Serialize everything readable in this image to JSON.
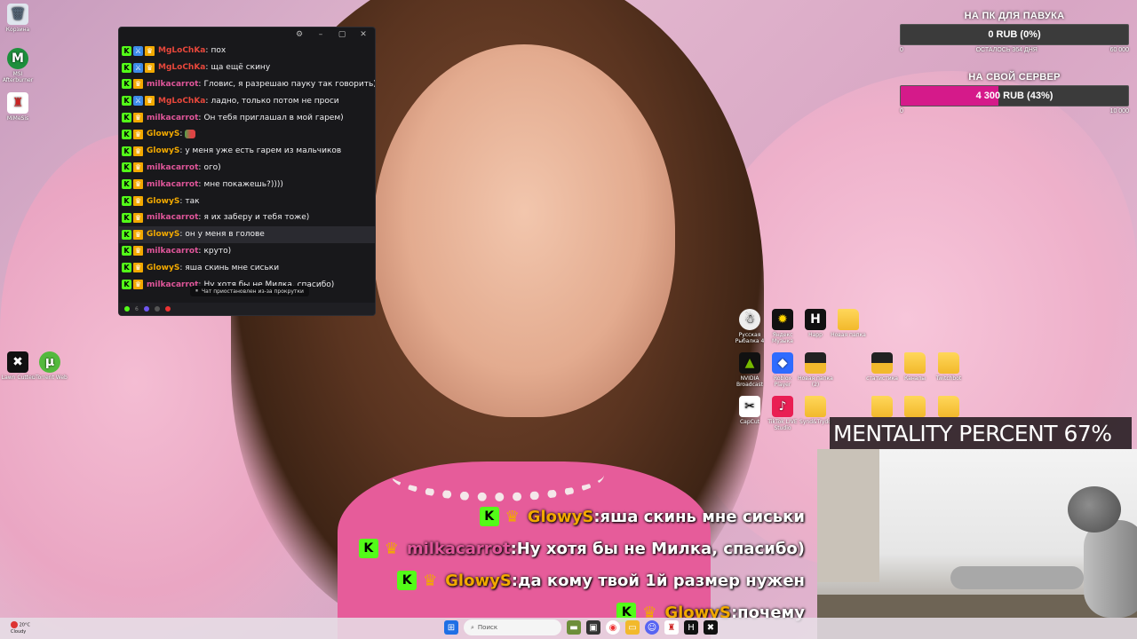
{
  "desktop": {
    "left_icons": [
      {
        "label": "Корзина",
        "icon": "recycle-bin-icon"
      },
      {
        "label": "MSI Afterburner",
        "icon": "msi-afterburner-icon"
      },
      {
        "label": "MiMeSis",
        "icon": "mimesis-icon"
      }
    ],
    "left_lower_icons": [
      {
        "label": "Lawn Cutter",
        "icon": "game-icon"
      },
      {
        "label": "uTorrent Web",
        "icon": "utorrent-icon"
      }
    ],
    "right_icons_row1": [
      {
        "label": "Русская Рыбалка 4",
        "icon": "fishing-game-icon"
      },
      {
        "label": "Яндекс Музыка",
        "icon": "yandex-music-icon"
      },
      {
        "label": "Hapр",
        "icon": "hamp-icon"
      },
      {
        "label": "Новая папка",
        "icon": "folder-icon"
      }
    ],
    "right_icons_row2": [
      {
        "label": "NVIDIA Broadcast",
        "icon": "nvidia-icon"
      },
      {
        "label": "Roblox Player",
        "icon": "roblox-icon"
      },
      {
        "label": "Новая папка (2)",
        "icon": "folder-icon"
      },
      {
        "label": "статистика",
        "icon": "folder-icon"
      },
      {
        "label": "Каналы",
        "icon": "folder-icon"
      },
      {
        "label": "Twitchbot",
        "icon": "folder-icon"
      }
    ],
    "right_icons_row3": [
      {
        "label": "CapCut",
        "icon": "capcut-icon"
      },
      {
        "label": "TikTok LIVE Studio",
        "icon": "tiktok-icon"
      },
      {
        "label": "Synd&Trydo",
        "icon": "folder-icon"
      },
      {
        "label": "",
        "icon": "folder-icon"
      },
      {
        "label": "",
        "icon": "folder-icon"
      },
      {
        "label": "",
        "icon": "folder-icon"
      }
    ]
  },
  "chat_window": {
    "controls": {
      "settings": "⚙",
      "minimize": "–",
      "maximize": "▢",
      "close": "✕"
    },
    "messages": [
      {
        "user": "MgLoChKa",
        "color": "#e8473b",
        "badges": [
          "kick",
          "mod",
          "crown"
        ],
        "text": "пох"
      },
      {
        "user": "MgLoChKa",
        "color": "#e8473b",
        "badges": [
          "kick",
          "mod",
          "crown"
        ],
        "text": "ща ещё скину"
      },
      {
        "user": "milkacarrot",
        "color": "#e0569a",
        "badges": [
          "kick",
          "crown"
        ],
        "text": "Гловис, я разрешаю пауку так говорить)"
      },
      {
        "user": "MgLoChKa",
        "color": "#e8473b",
        "badges": [
          "kick",
          "mod",
          "crown"
        ],
        "text": "ладно, только потом не проси"
      },
      {
        "user": "milkacarrot",
        "color": "#e0569a",
        "badges": [
          "kick",
          "crown"
        ],
        "text": "Он тебя приглашал в мой гарем)"
      },
      {
        "user": "GlowyS",
        "color": "#f2a900",
        "badges": [
          "kick",
          "crown"
        ],
        "text": "",
        "emote": true
      },
      {
        "user": "GlowyS",
        "color": "#f2a900",
        "badges": [
          "kick",
          "crown"
        ],
        "text": "у меня уже есть гарем из мальчиков"
      },
      {
        "user": "milkacarrot",
        "color": "#e0569a",
        "badges": [
          "kick",
          "crown"
        ],
        "text": "ого)"
      },
      {
        "user": "milkacarrot",
        "color": "#e0569a",
        "badges": [
          "kick",
          "crown"
        ],
        "text": "мне покажешь?))))"
      },
      {
        "user": "GlowyS",
        "color": "#f2a900",
        "badges": [
          "kick",
          "crown"
        ],
        "text": "так"
      },
      {
        "user": "milkacarrot",
        "color": "#e0569a",
        "badges": [
          "kick",
          "crown"
        ],
        "text": "я их заберу и тебя тоже)"
      },
      {
        "user": "GlowyS",
        "color": "#f2a900",
        "badges": [
          "kick",
          "crown"
        ],
        "text": "он у меня в голове",
        "highlight": true
      },
      {
        "user": "milkacarrot",
        "color": "#e0569a",
        "badges": [
          "kick",
          "crown"
        ],
        "text": "круто)"
      },
      {
        "user": "GlowyS",
        "color": "#f2a900",
        "badges": [
          "kick",
          "crown"
        ],
        "text": "яша скинь мне сиськи"
      },
      {
        "user": "milkacarrot",
        "color": "#e0569a",
        "badges": [
          "kick",
          "crown"
        ],
        "text": "Ну хотя бы не Милка, спасибо)"
      }
    ],
    "pause_notice": "Чат приостановлен из-за прокрутки",
    "footer_count": "6"
  },
  "goals": [
    {
      "title": "НА ПК ДЛЯ ПАВУКА",
      "value_text": "0 RUB (0%)",
      "progress": 0,
      "min": "0",
      "note": "ОСТАЛОСЬ 364 ДНЯ",
      "max": "60 000"
    },
    {
      "title": "НА СВОЙ СЕРВЕР",
      "value_text": "4 300 RUB (43%)",
      "progress": 0.43,
      "min": "0",
      "note": "",
      "max": "10 000"
    }
  ],
  "mentality": "MENTALITY PERCENT 67%",
  "overlay_chat": [
    {
      "user": "GlowyS",
      "color": "#f2a900",
      "text": "яша скинь мне сиськи"
    },
    {
      "user": "milkacarrot",
      "color": "#e0569a",
      "text": "Ну хотя бы не Милка, спасибо)"
    },
    {
      "user": "GlowyS",
      "color": "#f2a900",
      "text": "да кому твой 1й размер нужен"
    },
    {
      "user": "GlowyS",
      "color": "#f2a900",
      "text": "почему"
    }
  ],
  "taskbar": {
    "weather_temp": "20°C",
    "weather_cond": "Cloudy",
    "search_placeholder": "Поиск"
  }
}
